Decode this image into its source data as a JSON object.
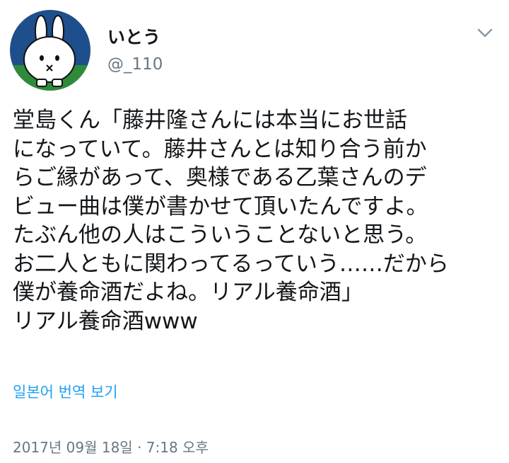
{
  "user": {
    "display_name": "いとう",
    "handle": "@_110",
    "avatar_icon": "rabbit-avatar-icon"
  },
  "tweet": {
    "text": "堂島くん「藤井隆さんには本当にお世話\nになっていて。藤井さんとは知り合う前か\nらご縁があって、奥様である乙葉さんのデ\nビュー曲は僕が書かせて頂いたんですよ。\nたぶん他の人はこういうことないと思う。\nお二人ともに関わってるっていう……だから\n僕が養命酒だよね。リアル養命酒」\nリアル養命酒www",
    "translate_label": "일본어 번역 보기",
    "timestamp": "2017년 09월 18일 · 7:18 오후"
  },
  "menu": {
    "caret_icon": "chevron-down-icon"
  },
  "colors": {
    "text": "#14171a",
    "secondary": "#657786",
    "link": "#1da1f2",
    "avatar_bg": "#1f4e8c",
    "avatar_ground": "#2e8b3a"
  }
}
